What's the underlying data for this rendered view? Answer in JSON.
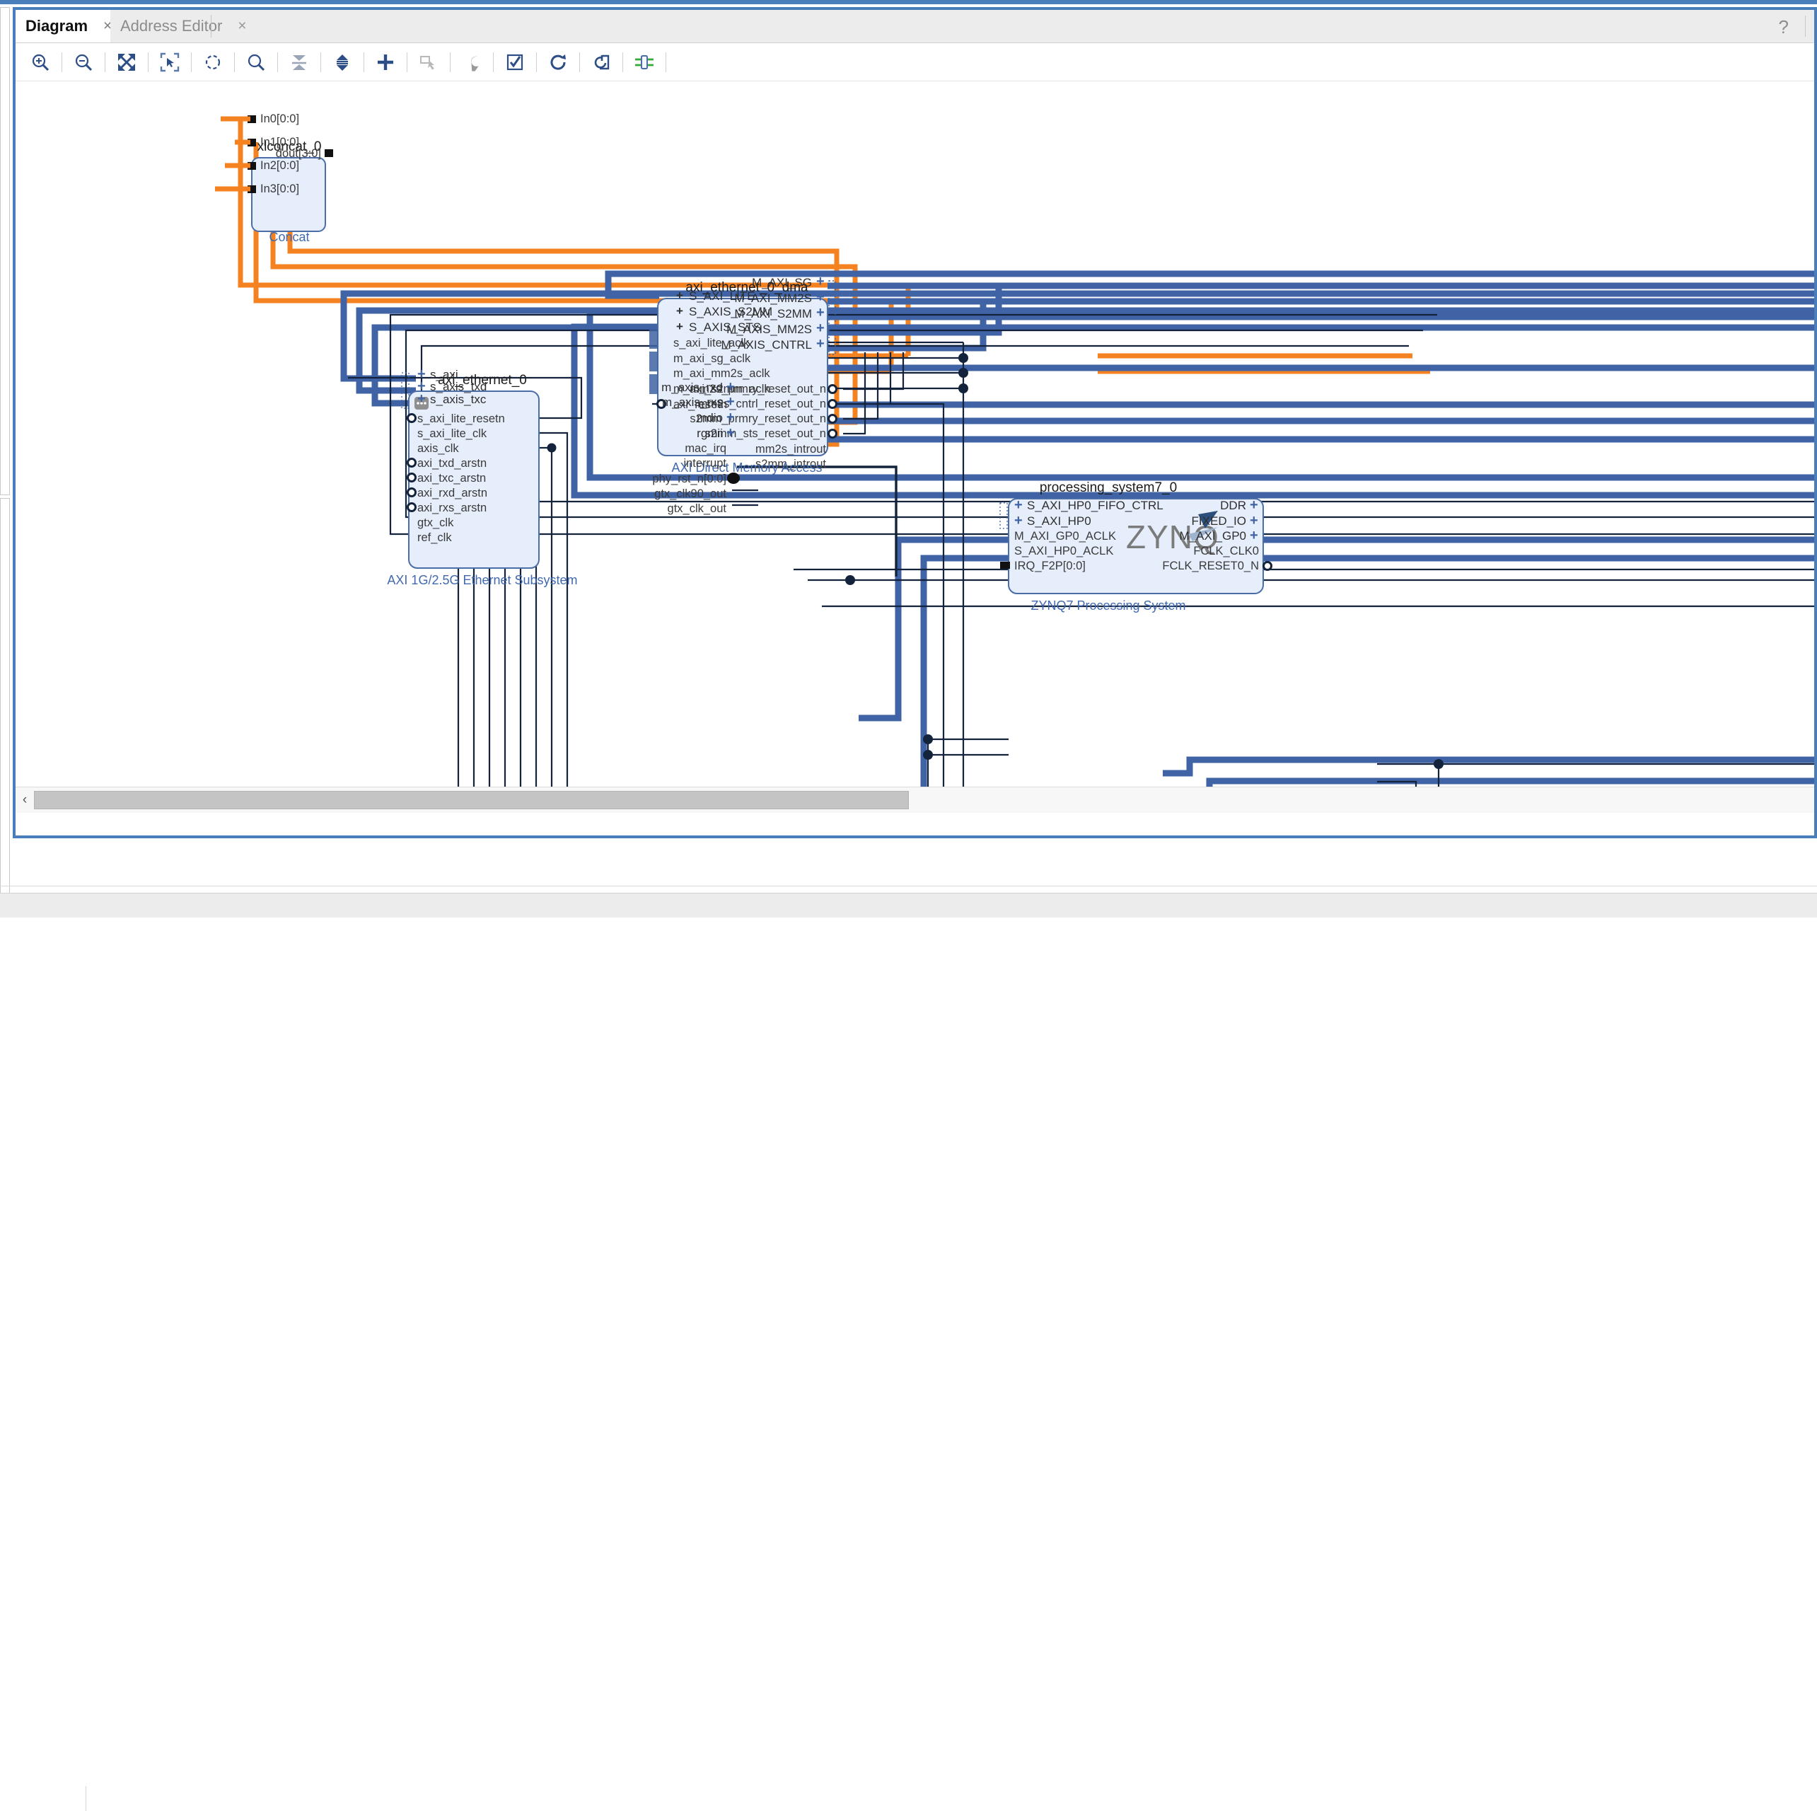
{
  "window": {
    "accent_color": "#4a7ebb",
    "tabs": [
      {
        "label": "Diagram",
        "active": true,
        "close": "×"
      },
      {
        "label": "Address Editor",
        "active": false,
        "close": "×"
      }
    ],
    "help_glyph": "?"
  },
  "toolbar": {
    "buttons": [
      {
        "name": "zoom-in-icon",
        "tip": "Zoom In"
      },
      {
        "name": "zoom-out-icon",
        "tip": "Zoom Out"
      },
      {
        "name": "zoom-fit-icon",
        "tip": "Zoom Fit"
      },
      {
        "name": "zoom-area-icon",
        "tip": "Zoom Area"
      },
      {
        "name": "fit-selection-icon",
        "tip": "Fit Selection"
      },
      {
        "name": "search-icon",
        "tip": "Search"
      },
      {
        "name": "collapse-all-icon",
        "tip": "Collapse All"
      },
      {
        "name": "expand-all-icon",
        "tip": "Expand All"
      },
      {
        "name": "add-ip-icon",
        "tip": "Add IP"
      },
      {
        "name": "add-module-icon",
        "tip": "Add Module"
      },
      {
        "name": "run-connection-automation-icon",
        "tip": "Run Connection Automation"
      },
      {
        "name": "validate-design-icon",
        "tip": "Validate Design"
      },
      {
        "name": "regenerate-layout-icon",
        "tip": "Regenerate Layout"
      },
      {
        "name": "optimize-routing-icon",
        "tip": "Optimize Routing"
      },
      {
        "name": "show-interfaces-icon",
        "tip": "Show Interface Connections"
      }
    ]
  },
  "scrollbar": {
    "left_arrow": "‹"
  },
  "diagram": {
    "blocks": [
      {
        "id": "xlconcat_0",
        "title": "xlconcat_0",
        "subtitle": "Concat",
        "inputs": [
          "In0[0:0]",
          "In1[0:0]",
          "In2[0:0]",
          "In3[0:0]"
        ],
        "outputs": [
          "dout[3:0]"
        ]
      },
      {
        "id": "axi_ethernet_0_dma",
        "title": "axi_ethernet_0_dma",
        "subtitle": "AXI Direct Memory Access",
        "inputs": [
          "S_AXI_LITE",
          "S_AXIS_S2MM",
          "S_AXIS_STS",
          "s_axi_lite_aclk",
          "m_axi_sg_aclk",
          "m_axi_mm2s_aclk",
          "m_axi_s2mm_aclk",
          "axi_resetn"
        ],
        "outputs": [
          "M_AXI_SG",
          "M_AXI_MM2S",
          "M_AXI_S2MM",
          "M_AXIS_MM2S",
          "M_AXIS_CNTRL",
          "mm2s_prmry_reset_out_n",
          "mm2s_cntrl_reset_out_n",
          "s2mm_prmry_reset_out_n",
          "s2mm_sts_reset_out_n",
          "mm2s_introut",
          "s2mm_introut"
        ]
      },
      {
        "id": "axi_ethernet_0",
        "title": "axi_ethernet_0",
        "subtitle": "AXI 1G/2.5G Ethernet Subsystem",
        "inputs": [
          "s_axi",
          "s_axis_txd",
          "s_axis_txc",
          "s_axi_lite_resetn",
          "s_axi_lite_clk",
          "axis_clk",
          "axi_txd_arstn",
          "axi_txc_arstn",
          "axi_rxd_arstn",
          "axi_rxs_arstn",
          "gtx_clk",
          "ref_clk"
        ],
        "outputs": [
          "m_axis_rxd",
          "m_axis_rxs",
          "mdio",
          "rgmii",
          "mac_irq",
          "interrupt",
          "phy_rst_n[0:0]",
          "gtx_clk90_out",
          "gtx_clk_out"
        ]
      },
      {
        "id": "processing_system7_0",
        "title": "processing_system7_0",
        "subtitle": "ZYNQ7 Processing System",
        "logo": "ZYNQ",
        "inputs": [
          "S_AXI_HP0_FIFO_CTRL",
          "S_AXI_HP0",
          "M_AXI_GP0_ACLK",
          "S_AXI_HP0_ACLK",
          "IRQ_F2P[0:0]"
        ],
        "outputs": [
          "DDR",
          "FIXED_IO",
          "M_AXI_GP0",
          "FCLK_CLK0",
          "FCLK_RESET0_N"
        ]
      }
    ],
    "colors": {
      "interface_wire": "#3f63a4",
      "interrupt_wire": "#f58220",
      "signal_wire": "#14233c",
      "block_fill": "#e6eefc",
      "block_border": "#4b6ea9",
      "block_label": "#4169b0",
      "pin_plus": "#3f63a4"
    }
  }
}
